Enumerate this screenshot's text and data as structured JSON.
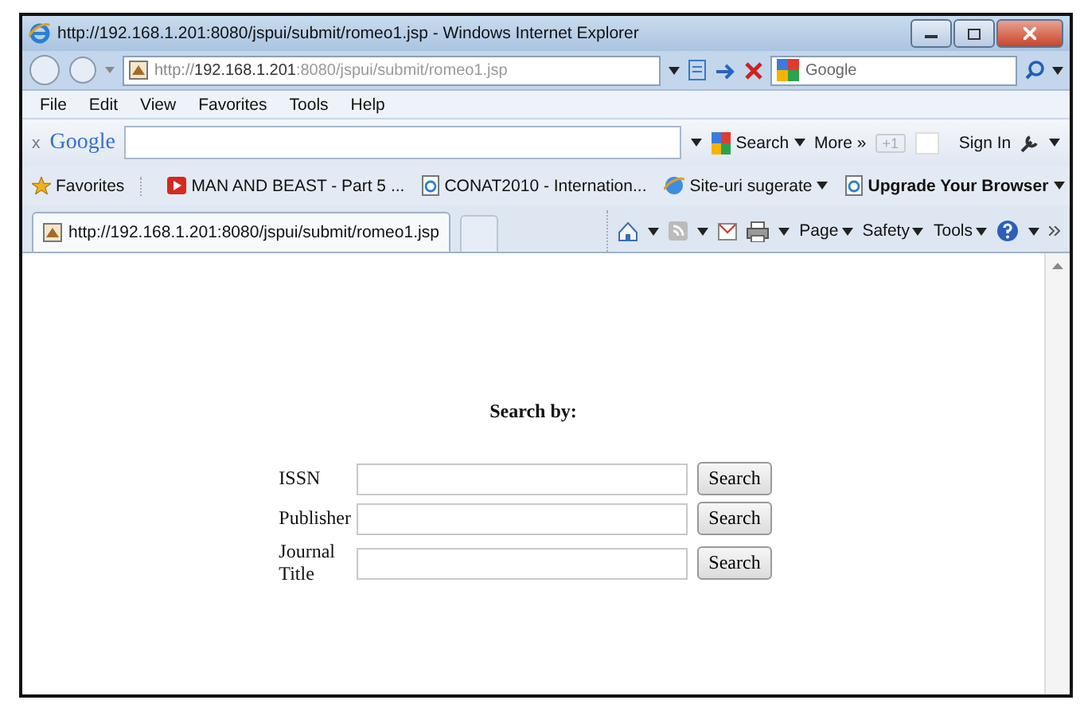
{
  "window": {
    "title": "http://192.168.1.201:8080/jspui/submit/romeo1.jsp - Windows Internet Explorer"
  },
  "address_bar": {
    "scheme": "http://",
    "host": "192.168.1.201",
    "path": ":8080/jspui/submit/romeo1.jsp",
    "search_placeholder": "Google"
  },
  "menu": [
    "File",
    "Edit",
    "View",
    "Favorites",
    "Tools",
    "Help"
  ],
  "google_toolbar": {
    "close": "x",
    "logo": "Google",
    "search": "Search",
    "more": "More »",
    "plus_one": "+1",
    "sign_in": "Sign In"
  },
  "favorites_bar": {
    "label": "Favorites",
    "items": [
      {
        "label": "MAN AND BEAST - Part 5 ...",
        "kind": "video",
        "bold": false,
        "dropdown": false
      },
      {
        "label": "CONAT2010 - Internation...",
        "kind": "page",
        "bold": false,
        "dropdown": false
      },
      {
        "label": "Site-uri sugerate",
        "kind": "sites",
        "bold": false,
        "dropdown": true
      },
      {
        "label": "Upgrade Your Browser",
        "kind": "page",
        "bold": true,
        "dropdown": true
      }
    ]
  },
  "tabs": [
    {
      "label": "http://192.168.1.201:8080/jspui/submit/romeo1.jsp",
      "selected": true
    }
  ],
  "command_bar": [
    "Page",
    "Safety",
    "Tools"
  ],
  "form": {
    "heading": "Search by:",
    "rows": [
      {
        "label": "ISSN",
        "button": "Search"
      },
      {
        "label": "Publisher",
        "button": "Search"
      },
      {
        "label": "Journal Title",
        "button": "Search"
      }
    ]
  }
}
